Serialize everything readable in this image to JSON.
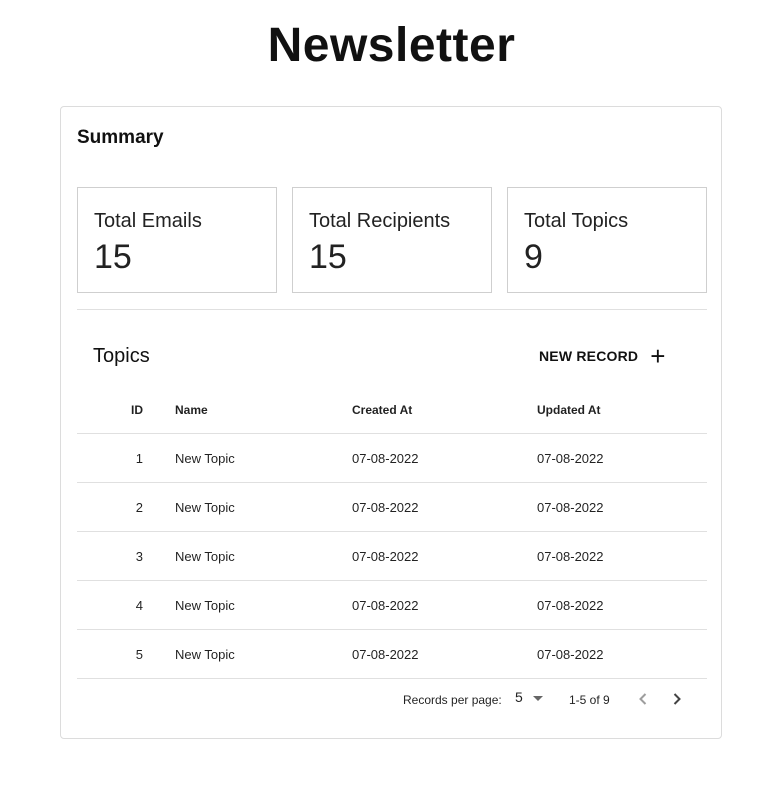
{
  "page": {
    "title": "Newsletter"
  },
  "summary": {
    "title": "Summary",
    "stats": [
      {
        "label": "Total Emails",
        "value": "15"
      },
      {
        "label": "Total Recipients",
        "value": "15"
      },
      {
        "label": "Total Topics",
        "value": "9"
      }
    ]
  },
  "topics": {
    "title": "Topics",
    "new_record_label": "NEW RECORD",
    "columns": [
      "ID",
      "Name",
      "Created At",
      "Updated At"
    ],
    "rows": [
      {
        "id": "1",
        "name": "New Topic",
        "created": "07-08-2022",
        "updated": "07-08-2022"
      },
      {
        "id": "2",
        "name": "New Topic",
        "created": "07-08-2022",
        "updated": "07-08-2022"
      },
      {
        "id": "3",
        "name": "New Topic",
        "created": "07-08-2022",
        "updated": "07-08-2022"
      },
      {
        "id": "4",
        "name": "New Topic",
        "created": "07-08-2022",
        "updated": "07-08-2022"
      },
      {
        "id": "5",
        "name": "New Topic",
        "created": "07-08-2022",
        "updated": "07-08-2022"
      }
    ]
  },
  "pagination": {
    "per_page_label": "Records per page:",
    "per_page_value": "5",
    "range": "1-5 of 9"
  },
  "icons": {
    "add": "plus-icon",
    "prev": "chevron-left-icon",
    "next": "chevron-right-icon",
    "dropdown": "caret-down-icon"
  }
}
